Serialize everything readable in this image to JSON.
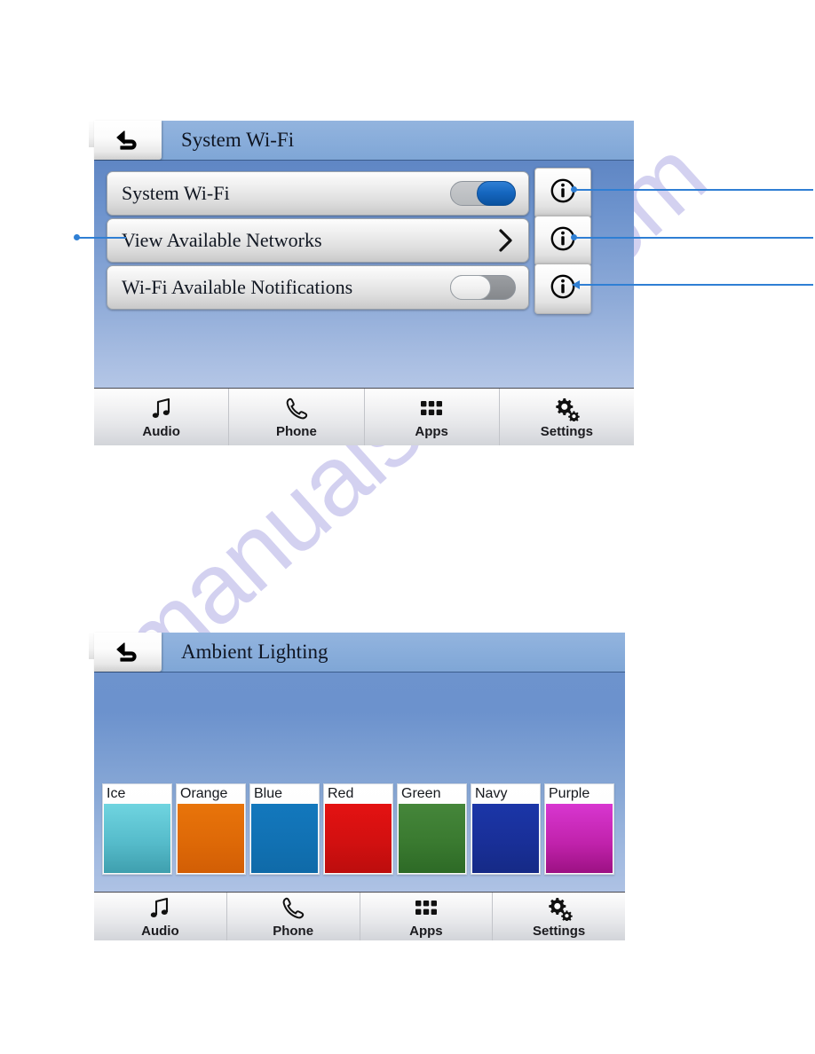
{
  "watermark": {
    "text": "manualshive.com",
    "color": "#b9b6e8"
  },
  "screens": [
    {
      "id": "system-wifi",
      "title": "System Wi-Fi",
      "back_icon": "back-arrow-icon",
      "rows": [
        {
          "label": "System Wi-Fi",
          "control": "toggle",
          "state": "on",
          "info_icon": "info-icon"
        },
        {
          "label": "View Available Networks",
          "control": "chevron",
          "state": "",
          "info_icon": "info-icon"
        },
        {
          "label": "Wi-Fi Available Notifications",
          "control": "toggle",
          "state": "off",
          "info_icon": "info-icon"
        }
      ],
      "nav": [
        {
          "label": "Audio",
          "icon": "music-note-icon"
        },
        {
          "label": "Phone",
          "icon": "phone-handset-icon"
        },
        {
          "label": "Apps",
          "icon": "grid-apps-icon"
        },
        {
          "label": "Settings",
          "icon": "gears-icon"
        }
      ]
    },
    {
      "id": "ambient-lighting",
      "title": "Ambient Lighting",
      "back_icon": "back-arrow-icon",
      "swatches": [
        {
          "label": "Ice",
          "color_top": "#6fd4e0",
          "color_bottom": "#3f9fae"
        },
        {
          "label": "Orange",
          "color_top": "#e8740a",
          "color_bottom": "#d25e05"
        },
        {
          "label": "Blue",
          "color_top": "#1378bd",
          "color_bottom": "#0f6aa8"
        },
        {
          "label": "Red",
          "color_top": "#e41212",
          "color_bottom": "#bc0d0d"
        },
        {
          "label": "Green",
          "color_top": "#45863a",
          "color_bottom": "#2d6a26"
        },
        {
          "label": "Navy",
          "color_top": "#1b36a8",
          "color_bottom": "#152a86"
        },
        {
          "label": "Purple",
          "color_top": "#d836d0",
          "color_bottom": "#9c1183"
        }
      ],
      "nav": [
        {
          "label": "Audio",
          "icon": "music-note-icon"
        },
        {
          "label": "Phone",
          "icon": "phone-handset-icon"
        },
        {
          "label": "Apps",
          "icon": "grid-apps-icon"
        },
        {
          "label": "Settings",
          "icon": "gears-icon"
        }
      ]
    }
  ]
}
